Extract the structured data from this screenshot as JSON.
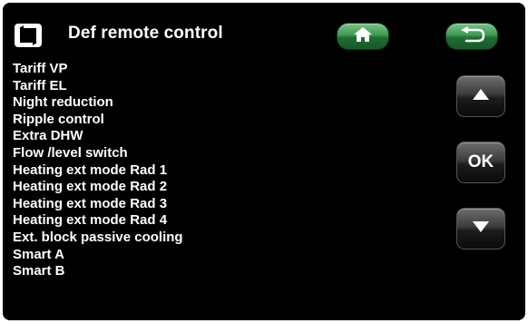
{
  "header": {
    "title": "Def remote control",
    "app_icon": "remote-control-icon",
    "home_icon": "home-icon",
    "back_icon": "return-arrow-icon"
  },
  "menu": {
    "items": [
      "Tariff VP",
      "Tariff EL",
      "Night reduction",
      "Ripple control",
      "Extra DHW",
      "Flow /level switch",
      "Heating ext mode Rad 1",
      "Heating ext mode Rad 2",
      "Heating ext mode Rad 3",
      "Heating ext mode Rad 4",
      "Ext. block passive cooling",
      "Smart A",
      "Smart B"
    ]
  },
  "nav": {
    "up_icon": "triangle-up-icon",
    "ok_label": "OK",
    "down_icon": "triangle-down-icon"
  },
  "colors": {
    "background": "#000000",
    "text": "#ffffff",
    "header_button": "#2e8a45",
    "nav_button": "#3c3c3c"
  }
}
